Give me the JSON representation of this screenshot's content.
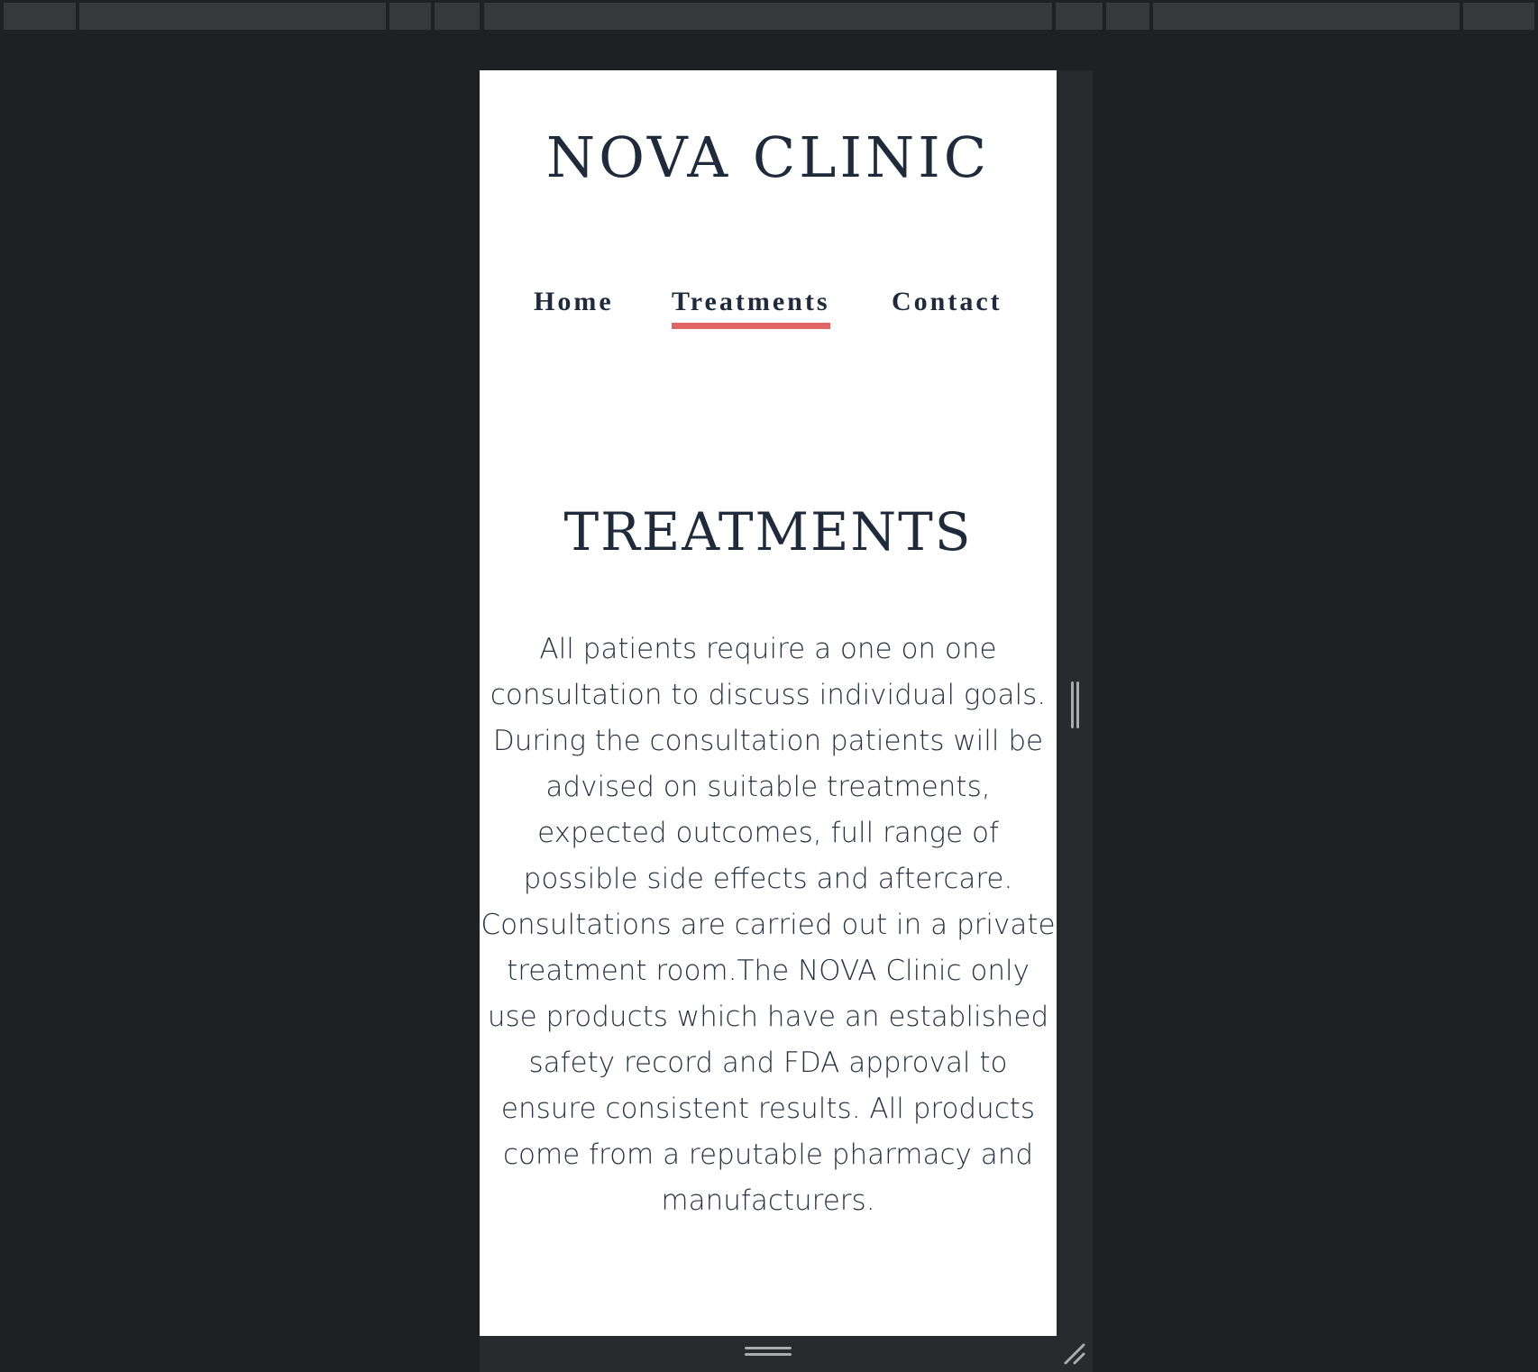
{
  "site": {
    "logo": "NOVA CLINIC"
  },
  "nav": {
    "items": [
      {
        "label": "Home"
      },
      {
        "label": "Treatments",
        "active": true
      },
      {
        "label": "Contact"
      }
    ],
    "active_underline_color": "#e06666"
  },
  "main": {
    "title": "TREATMENTS",
    "paragraph": "All patients require a one on one consultation to discuss individual goals. During the consultation patients will be advised on suitable treatments, expected outcomes, full range of possible side effects and aftercare. Consultations are carried out in a private treatment room.The NOVA Clinic only use products which have an established safety record and FDA approval to ensure consistent results. All products come from a reputable pharmacy and manufacturers."
  },
  "colors": {
    "text": "#1f2a3a",
    "background": "#ffffff",
    "chrome": "#1f2023"
  }
}
